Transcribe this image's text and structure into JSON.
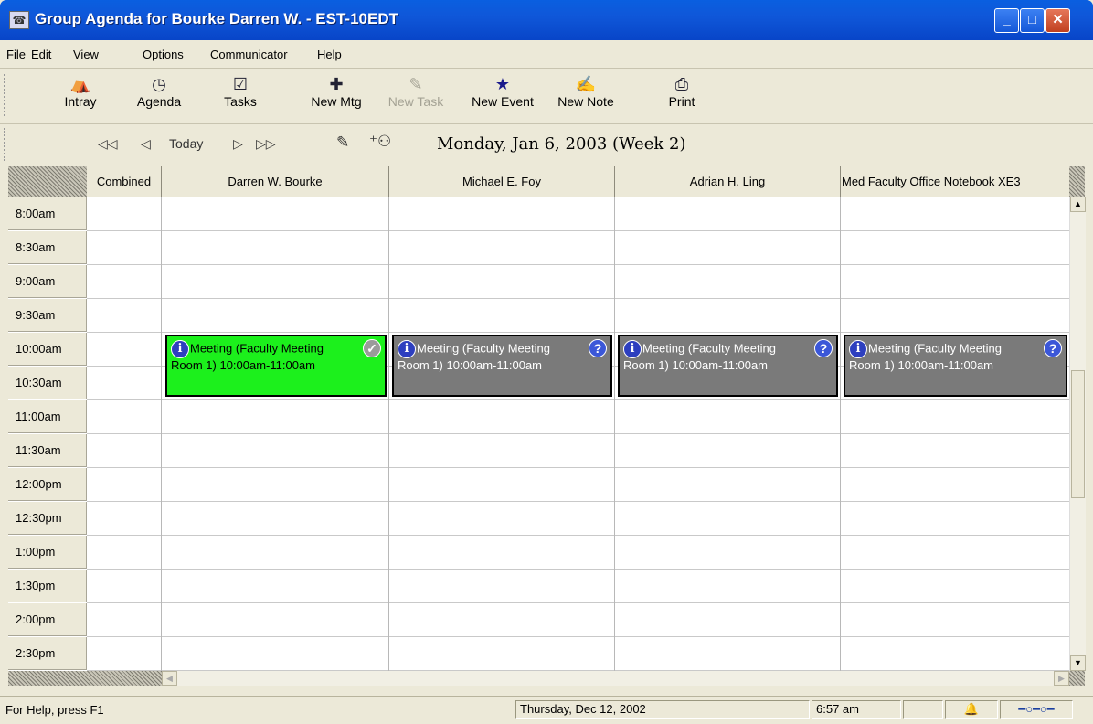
{
  "window": {
    "title": "Group Agenda for Bourke Darren W. - EST-10EDT",
    "minimize": "_",
    "maximize": "□",
    "close": "✕"
  },
  "menu": [
    "File",
    "Edit",
    "View",
    "Options",
    "Communicator",
    "Help"
  ],
  "toolbar": [
    {
      "label": "Intray",
      "icon": "⛺"
    },
    {
      "label": "Agenda",
      "icon": "◷"
    },
    {
      "label": "Tasks",
      "icon": "☑"
    },
    {
      "label": "New Mtg",
      "icon": "✚"
    },
    {
      "label": "New Task",
      "icon": "✎"
    },
    {
      "label": "New Event",
      "icon": "★"
    },
    {
      "label": "New Note",
      "icon": "✍"
    },
    {
      "label": "Print",
      "icon": "⎙"
    }
  ],
  "nav": {
    "first": "◁◁",
    "prev": "◁",
    "today": "Today",
    "next": "▷",
    "last": "▷▷",
    "goto_icon": "✎",
    "people_icon": "⁺⚇",
    "date": "Monday, Jan 6, 2003  (Week 2)"
  },
  "columns": [
    "Combined",
    "Darren W. Bourke",
    "Michael E. Foy",
    "Adrian H. Ling",
    "Med Faculty Office Notebook XE3"
  ],
  "times": [
    "8:00am",
    "8:30am",
    "9:00am",
    "9:30am",
    "10:00am",
    "10:30am",
    "11:00am",
    "11:30am",
    "12:00pm",
    "12:30pm",
    "1:00pm",
    "1:30pm",
    "2:00pm",
    "2:30pm"
  ],
  "appointments": [
    {
      "line1": "Meeting (Faculty Meeting",
      "line2": "Room 1) 10:00am-11:00am",
      "status": "✓"
    },
    {
      "line1": "Meeting (Faculty Meeting",
      "line2": "Room 1) 10:00am-11:00am",
      "status": "?"
    },
    {
      "line1": "Meeting (Faculty Meeting",
      "line2": "Room 1) 10:00am-11:00am",
      "status": "?"
    },
    {
      "line1": "Meeting (Faculty Meeting",
      "line2": "Room 1) 10:00am-11:00am",
      "status": "?"
    }
  ],
  "status": {
    "help": "For Help, press F1",
    "date": "Thursday, Dec 12, 2002",
    "time": "6:57 am"
  },
  "colors": {
    "accepted": "#1cf01c",
    "pending": "#7a7a7a"
  }
}
